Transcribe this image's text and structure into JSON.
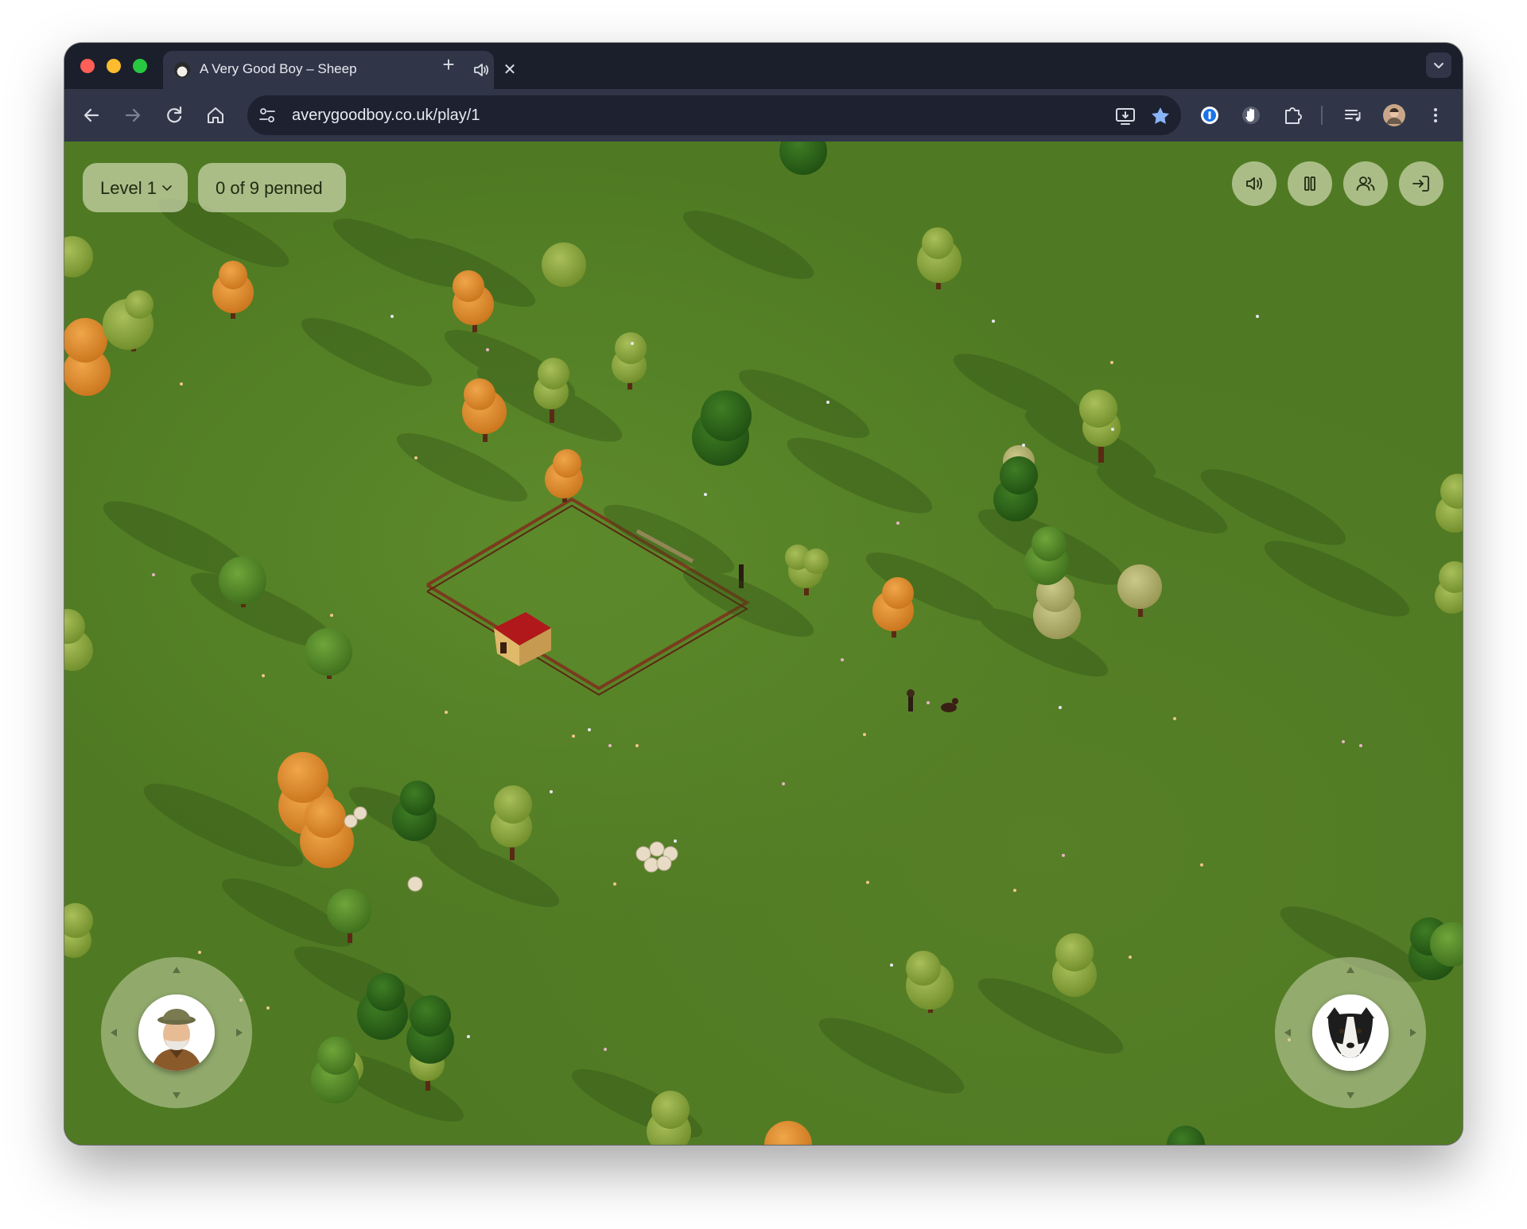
{
  "browser": {
    "tab": {
      "title": "A Very Good Boy – Sheep",
      "close_label": "✕",
      "new_tab_label": "+"
    },
    "url": "averygoodboy.co.uk/play/1",
    "icons": {
      "back": "back-arrow-icon",
      "forward": "forward-arrow-icon",
      "reload": "reload-icon",
      "home": "home-icon",
      "site_info": "tune-icon",
      "install": "install-app-icon",
      "bookmark": "star-icon",
      "extension_1": "password-manager-icon",
      "extension_2": "hand-icon",
      "extensions": "puzzle-icon",
      "media": "media-queue-icon",
      "profile": "avatar",
      "menu": "kebab-menu-icon"
    }
  },
  "game": {
    "level_label": "Level 1",
    "penned_label": "0 of 9 penned",
    "buttons": {
      "sound": "sound-icon",
      "pause": "pause-icon",
      "multiplayer": "people-icon",
      "exit": "exit-icon"
    },
    "controls": {
      "left": "farmer-joystick",
      "right": "dog-joystick"
    },
    "colors": {
      "grass": "#4f7a23",
      "hud": "#cdd7af",
      "fence": "#7a3b1d",
      "barn_roof": "#c0181b"
    }
  }
}
